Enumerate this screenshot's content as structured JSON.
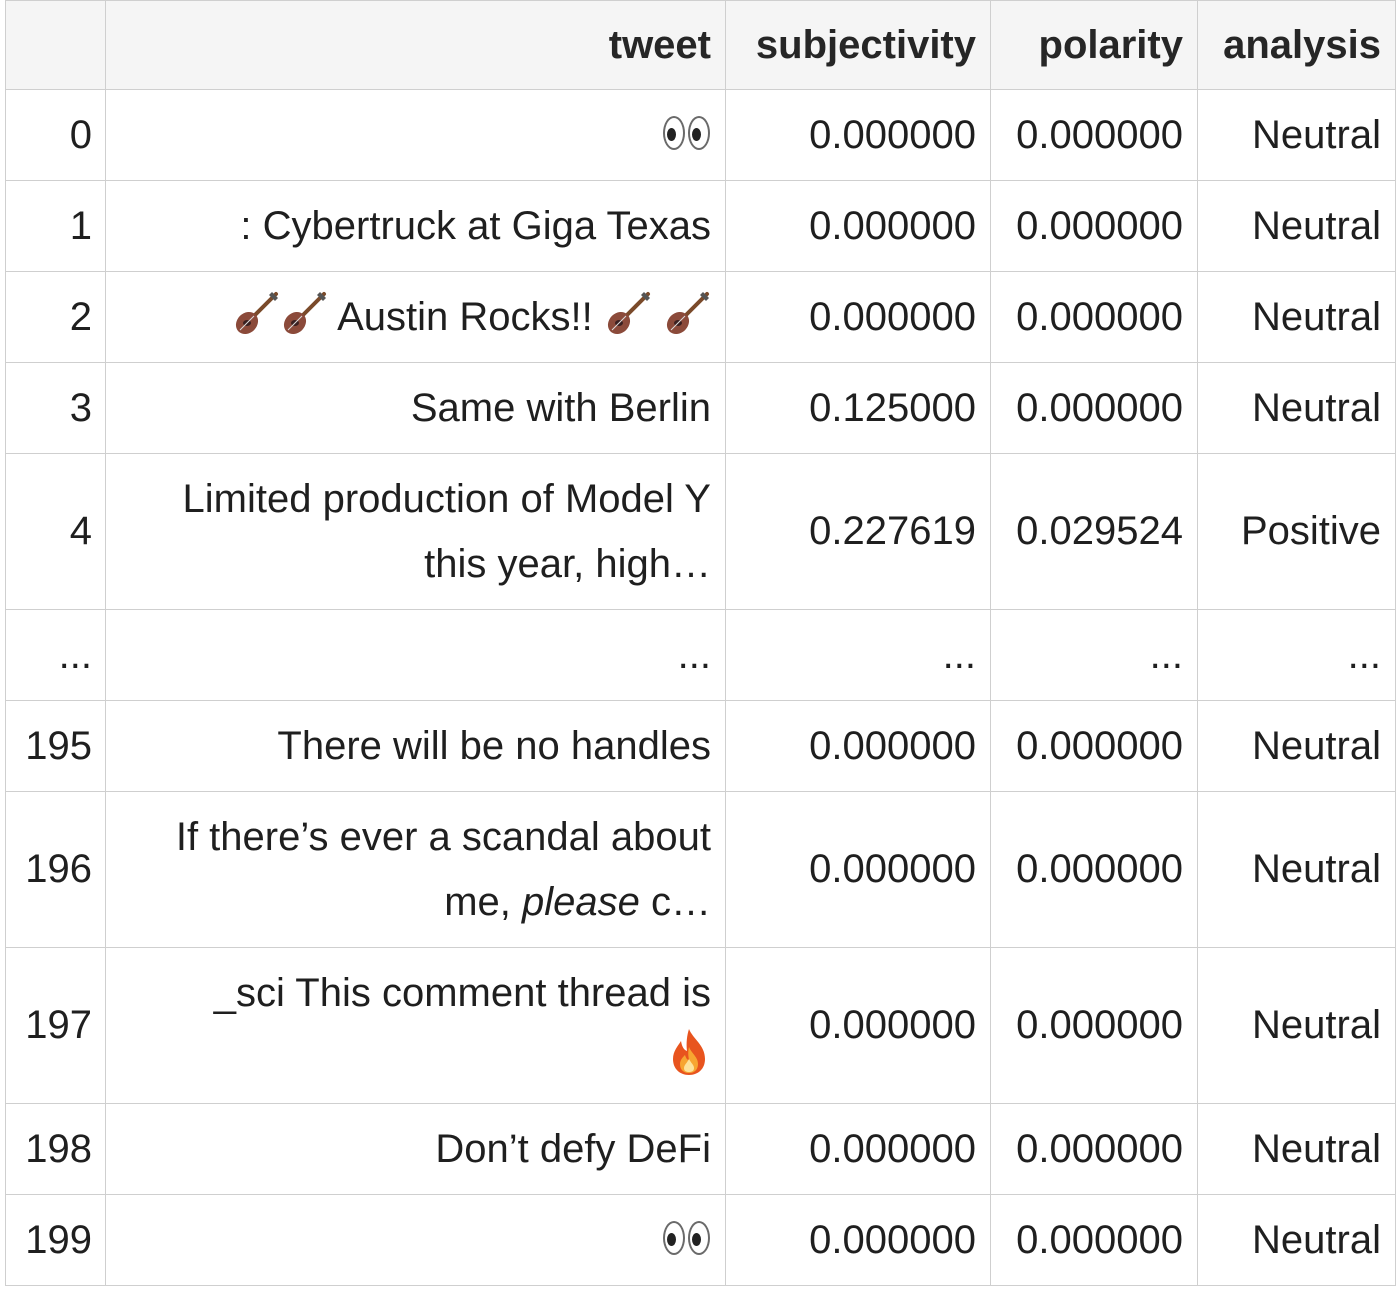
{
  "table": {
    "headers": {
      "index": "",
      "tweet": "tweet",
      "subjectivity": "subjectivity",
      "polarity": "polarity",
      "analysis": "analysis"
    },
    "rows": [
      {
        "index": "0",
        "tweet_icon": "eyes-emoji",
        "subjectivity": "0.000000",
        "polarity": "0.000000",
        "analysis": "Neutral"
      },
      {
        "index": "1",
        "tweet": ": Cybertruck at Giga Texas",
        "subjectivity": "0.000000",
        "polarity": "0.000000",
        "analysis": "Neutral"
      },
      {
        "index": "2",
        "tweet_text": "Austin Rocks!!",
        "tweet_icon": "guitar-emoji",
        "subjectivity": "0.000000",
        "polarity": "0.000000",
        "analysis": "Neutral"
      },
      {
        "index": "3",
        "tweet": "Same with Berlin",
        "subjectivity": "0.125000",
        "polarity": "0.000000",
        "analysis": "Neutral"
      },
      {
        "index": "4",
        "tweet_line1": "Limited production of Model Y",
        "tweet_line2": "this year, high…",
        "subjectivity": "0.227619",
        "polarity": "0.029524",
        "analysis": "Positive"
      },
      {
        "index": "...",
        "tweet": "...",
        "subjectivity": "...",
        "polarity": "...",
        "analysis": "..."
      },
      {
        "index": "195",
        "tweet": "There will be no handles",
        "subjectivity": "0.000000",
        "polarity": "0.000000",
        "analysis": "Neutral"
      },
      {
        "index": "196",
        "tweet_line1": "If there’s ever a scandal about",
        "tweet_line2a": "me, ",
        "tweet_line2_em": "please",
        "tweet_line2b": " c…",
        "subjectivity": "0.000000",
        "polarity": "0.000000",
        "analysis": "Neutral"
      },
      {
        "index": "197",
        "tweet_line1": "_sci This comment thread is",
        "tweet_icon": "fire-emoji",
        "subjectivity": "0.000000",
        "polarity": "0.000000",
        "analysis": "Neutral"
      },
      {
        "index": "198",
        "tweet": "Don’t defy DeFi",
        "subjectivity": "0.000000",
        "polarity": "0.000000",
        "analysis": "Neutral"
      },
      {
        "index": "199",
        "tweet_icon": "eyes-emoji",
        "subjectivity": "0.000000",
        "polarity": "0.000000",
        "analysis": "Neutral"
      }
    ]
  }
}
